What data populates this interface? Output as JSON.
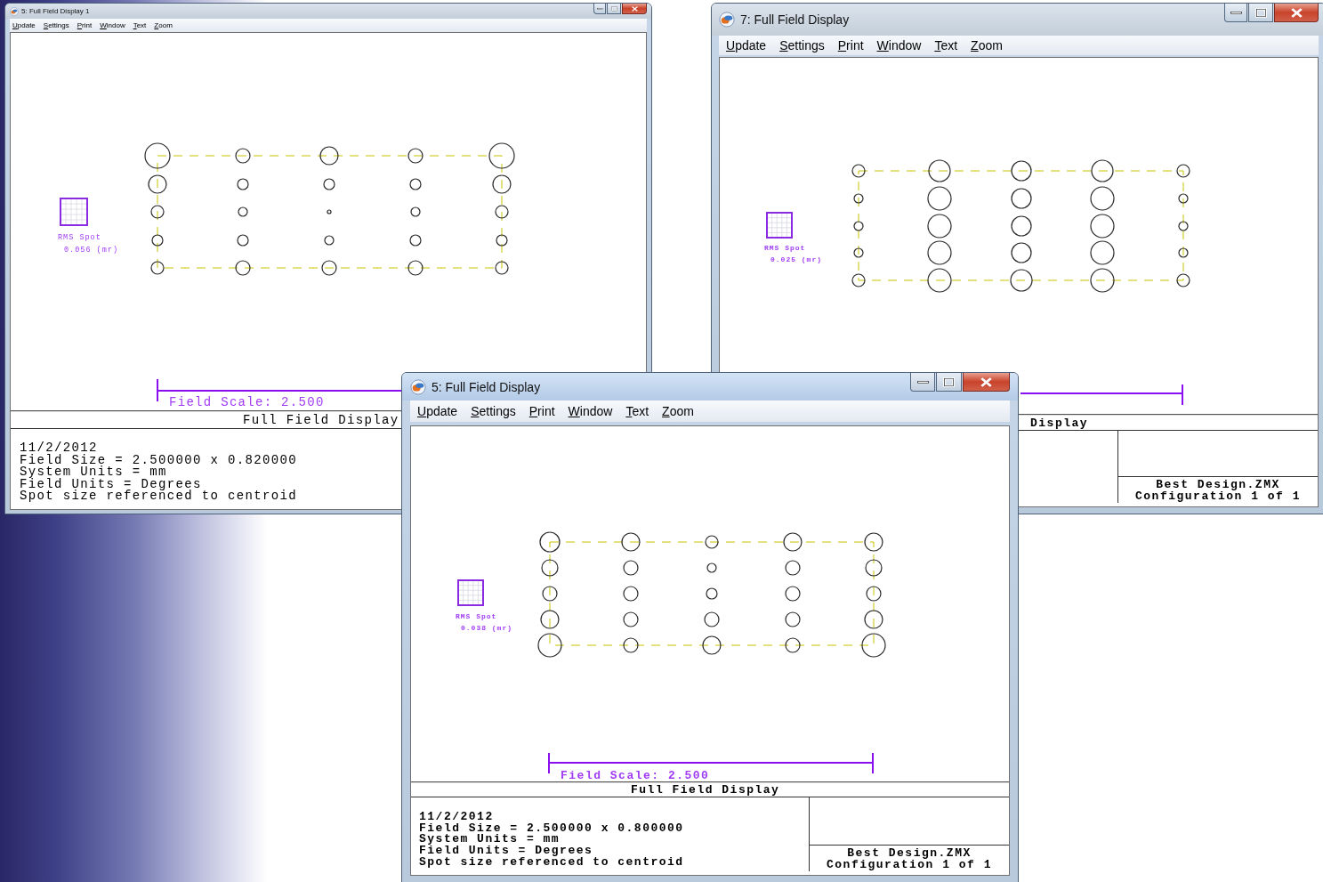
{
  "desktop": {
    "windows": [
      {
        "title": "5: Full Field Display 1",
        "active": false,
        "menu": [
          "Update",
          "Settings",
          "Print",
          "Window",
          "Text",
          "Zoom"
        ],
        "rms_spot": {
          "label": "RMS Spot",
          "value": "0.056 (mr)"
        },
        "field_scale": "Field Scale: 2.500",
        "footer": {
          "title": "Full Field Display",
          "notes": [
            "11/2/2012",
            "Field Size = 2.500000 x 0.820000",
            "System Units = mm",
            "Field Units = Degrees",
            "Spot size referenced to centroid"
          ]
        }
      },
      {
        "title": "7: Full Field Display",
        "active": false,
        "menu": [
          "Update",
          "Settings",
          "Print",
          "Window",
          "Text",
          "Zoom"
        ],
        "rms_spot": {
          "label": "RMS Spot",
          "value": "0.025 (mr)"
        },
        "footer": {
          "title": "Display",
          "file": "Best Design.ZMX",
          "configuration": "Configuration 1 of 1"
        }
      },
      {
        "title": "5: Full Field Display",
        "active": true,
        "menu": [
          "Update",
          "Settings",
          "Print",
          "Window",
          "Text",
          "Zoom"
        ],
        "rms_spot": {
          "label": "RMS Spot",
          "value": "0.038 (mr)"
        },
        "field_scale": "Field Scale: 2.500",
        "footer": {
          "title": "Full Field Display",
          "notes": [
            "11/2/2012",
            "Field Size = 2.500000 x 0.800000",
            "System Units = mm",
            "Field Units = Degrees",
            "Spot size referenced to centroid"
          ],
          "file": "Best Design.ZMX",
          "configuration": "Configuration 1 of 1"
        }
      }
    ]
  }
}
